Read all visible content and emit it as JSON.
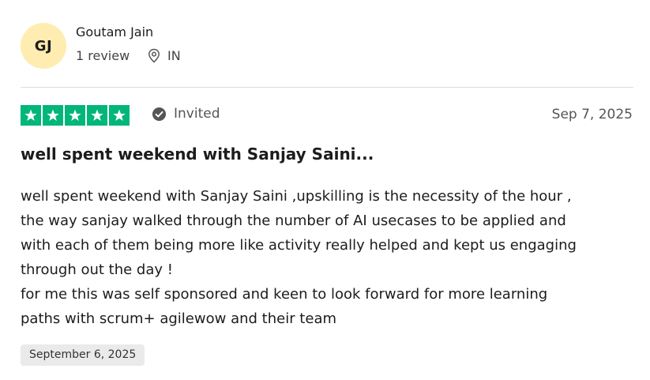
{
  "reviewer": {
    "initials": "GJ",
    "name": "Goutam Jain",
    "review_count": "1 review",
    "country": "IN"
  },
  "review": {
    "rating": 5,
    "rating_max": 5,
    "invited_label": "Invited",
    "date": "Sep 7, 2025",
    "title": "well spent weekend with Sanjay Saini...",
    "body": "well spent weekend with Sanjay Saini ,upskilling is the necessity of the hour ,\nthe way sanjay walked through the number of AI usecases to be applied and\nwith each of them being more like activity really helped and kept us engaging\nthrough out the day !\nfor me this was self sponsored and keen to look forward for more learning\npaths with scrum+ agilewow and their team",
    "experience_date": "September 6, 2025"
  },
  "colors": {
    "star_green": "#00b67a",
    "avatar_bg": "#ffecb0",
    "badge_bg": "#eaeaea"
  },
  "icons": {
    "location": "map-pin-icon",
    "invited": "check-circle-icon",
    "star": "star-icon"
  }
}
